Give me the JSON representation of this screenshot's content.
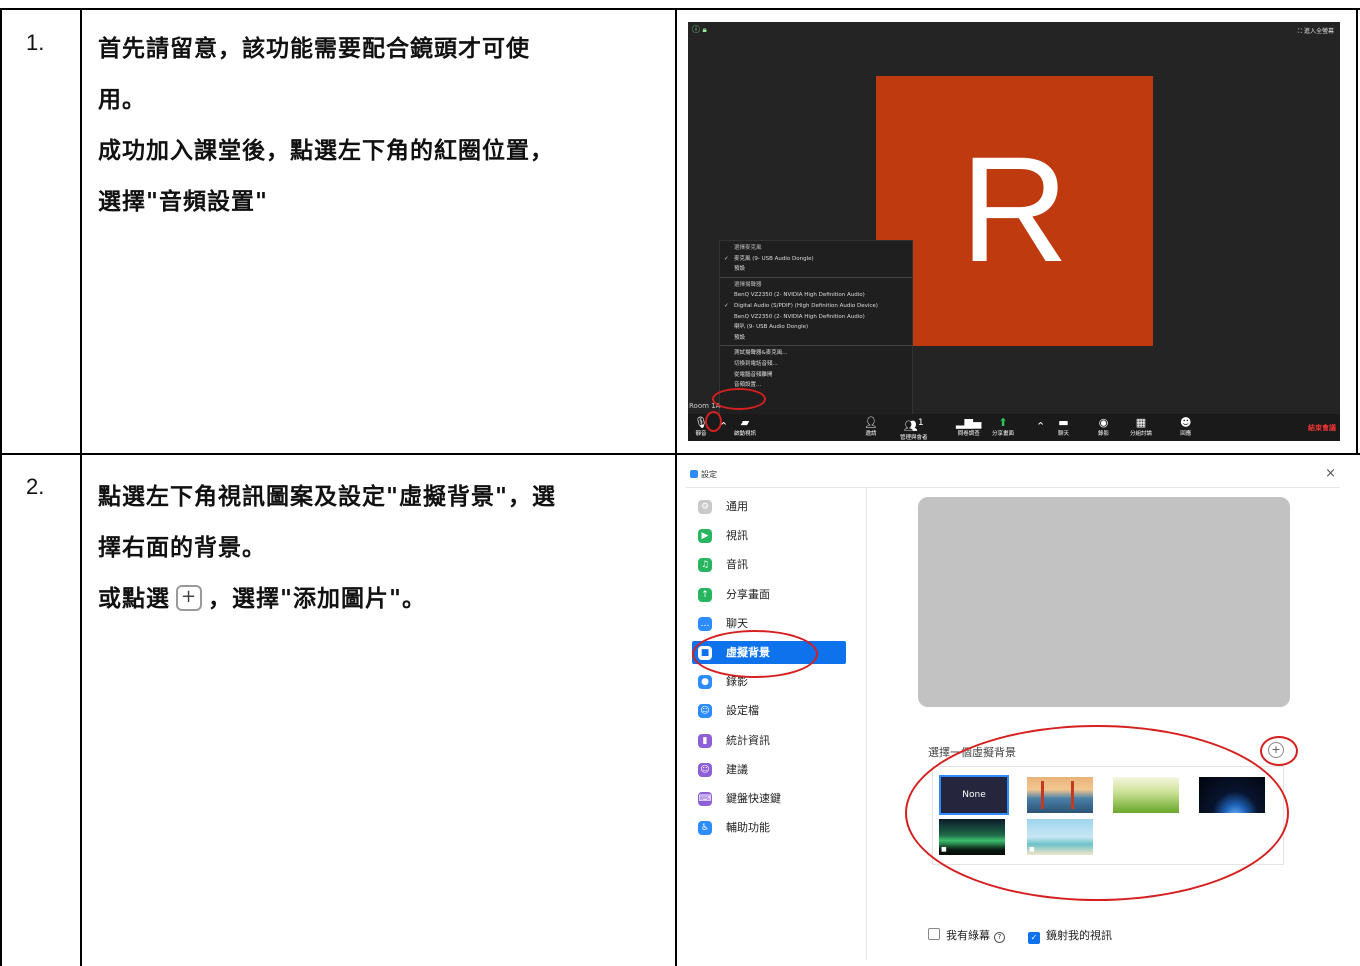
{
  "steps": [
    {
      "number": "1.",
      "lines": [
        "首先請留意，該功能需要配合鏡頭才可使",
        "用。",
        "成功加入課堂後，點選左下角的紅圈位置，",
        "選擇\"音頻設置\""
      ]
    },
    {
      "number": "2.",
      "lines": [
        "點選左下角視訊圖案及設定\"虛擬背景\"，選",
        "擇右面的背景。"
      ],
      "line3_before": "或點選",
      "line3_after": "，選擇\"添加圖片\"。"
    }
  ],
  "zoom": {
    "avatar_letter": "R",
    "room_label": "Room 1A",
    "fullscreen_label": "進入全螢幕",
    "menu": [
      {
        "text": "選擇麥克風",
        "type": "head"
      },
      {
        "text": "麥克風 (9- USB Audio Dongle)",
        "type": "chk"
      },
      {
        "text": "預設",
        "type": "item"
      },
      {
        "text": "選擇揚聲器",
        "type": "head"
      },
      {
        "text": "BenQ VZ2350 (2- NVIDIA High Definition Audio)",
        "type": "item"
      },
      {
        "text": "Digital Audio (S/PDIF) (High Definition Audio Device)",
        "type": "chk"
      },
      {
        "text": "BenQ VZ2350 (2- NVIDIA High Definition Audio)",
        "type": "item"
      },
      {
        "text": "喇叭 (9- USB Audio Dongle)",
        "type": "item"
      },
      {
        "text": "預設",
        "type": "item"
      },
      {
        "text": "測試揚聲器&麥克風...",
        "type": "item"
      },
      {
        "text": "切換到電話音頻...",
        "type": "item"
      },
      {
        "text": "從電腦音頻離開",
        "type": "item"
      },
      {
        "text": "音頻設置...",
        "type": "item"
      }
    ],
    "toolbar": {
      "mute": "靜音",
      "video": "啟動視訊",
      "invite": "邀請",
      "participants": "管理與會者",
      "participants_count": "1",
      "polls": "問卷調查",
      "share": "分享畫面",
      "chat": "聊天",
      "record": "錄影",
      "breakout": "分組討論",
      "reactions": "回應",
      "end": "結束會議"
    }
  },
  "settings": {
    "window_title": "設定",
    "nav": [
      {
        "label": "通用",
        "color": "#c9c9c9",
        "glyph": "⚙"
      },
      {
        "label": "視訊",
        "color": "#27b560",
        "glyph": "▶"
      },
      {
        "label": "音訊",
        "color": "#27b560",
        "glyph": "♫"
      },
      {
        "label": "分享畫面",
        "color": "#27b560",
        "glyph": "↑"
      },
      {
        "label": "聊天",
        "color": "#2d8cff",
        "glyph": "…"
      },
      {
        "label": "虛擬背景",
        "color": "#ffffff",
        "glyph": "■"
      },
      {
        "label": "錄影",
        "color": "#2d8cff",
        "glyph": "●"
      },
      {
        "label": "設定檔",
        "color": "#2d8cff",
        "glyph": "☺"
      },
      {
        "label": "統計資訊",
        "color": "#8f5fd8",
        "glyph": "▮"
      },
      {
        "label": "建議",
        "color": "#8f5fd8",
        "glyph": "☺"
      },
      {
        "label": "鍵盤快速鍵",
        "color": "#8f5fd8",
        "glyph": "⌨"
      },
      {
        "label": "輔助功能",
        "color": "#2d8cff",
        "glyph": "♿"
      }
    ],
    "choose_label": "選擇一個虛擬背景",
    "none_label": "None",
    "green_screen_label": "我有綠幕",
    "mirror_label": "鏡射我的視訊",
    "colors": {
      "accent": "#0e72ed",
      "annotation": "#d61f1f"
    }
  }
}
